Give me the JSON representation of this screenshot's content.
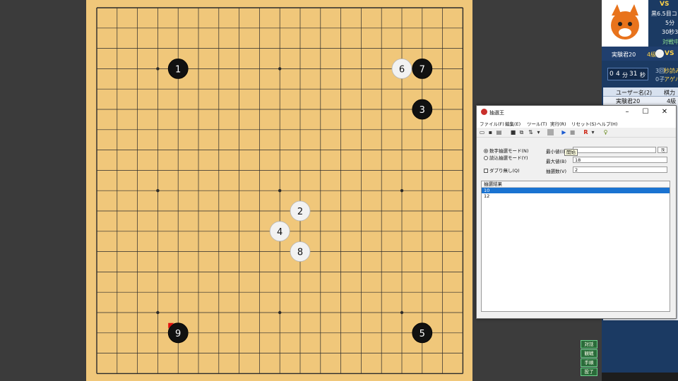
{
  "board": {
    "size": 19,
    "stones": [
      {
        "move": "1",
        "color": "black",
        "col": 4,
        "row": 3
      },
      {
        "move": "2",
        "color": "white",
        "col": 10,
        "row": 10
      },
      {
        "move": "3",
        "color": "black",
        "col": 16,
        "row": 5
      },
      {
        "move": "4",
        "color": "white",
        "col": 9,
        "row": 11
      },
      {
        "move": "5",
        "color": "black",
        "col": 16,
        "row": 16
      },
      {
        "move": "6",
        "color": "white",
        "col": 15,
        "row": 3
      },
      {
        "move": "7",
        "color": "black",
        "col": 16,
        "row": 3
      },
      {
        "move": "8",
        "color": "white",
        "col": 10,
        "row": 12
      },
      {
        "move": "9",
        "color": "black",
        "col": 4,
        "row": 16,
        "last": true
      }
    ]
  },
  "side_panel": {
    "vs": "VS",
    "rule": "黒6.5目コ",
    "time1": "5分",
    "time2": "30秒3",
    "status": "対戦中",
    "player_name": "実験君20",
    "player_rank": "4級",
    "timer_prefix": "0",
    "timer_min": "4",
    "timer_unit_min": "分",
    "timer_sec": "31",
    "timer_unit_sec": "秒",
    "counter": "3回",
    "byoyomi": "秒読み",
    "captures": "0子",
    "agehama": "アゲハマ",
    "list_col1": "ユーザー名(2)",
    "list_col2": "棋力",
    "list_row_name": "実験君20",
    "list_row_rank": "4級",
    "buttons": [
      "対話",
      "観戦",
      "手順",
      "投了"
    ]
  },
  "dialog": {
    "title": "抽選王",
    "menu": [
      "ファイル(F)",
      "編集(E)",
      "ツール(T)",
      "実行(R)",
      "リセット(S)",
      "ヘルプ(H)"
    ],
    "mode_numeric": "数字抽選モード(N)",
    "mode_file": "読込抽選モード(Y)",
    "no_duplicates": "ダブり無し(Q)",
    "min_label": "最小値(I)",
    "min_value": "",
    "max_label": "最大値(B)",
    "max_value": "18",
    "count_label": "抽選数(V)",
    "count_value": "2",
    "tooltip": "開始",
    "results_header": "抽選結果",
    "results": [
      "10",
      "12"
    ]
  }
}
